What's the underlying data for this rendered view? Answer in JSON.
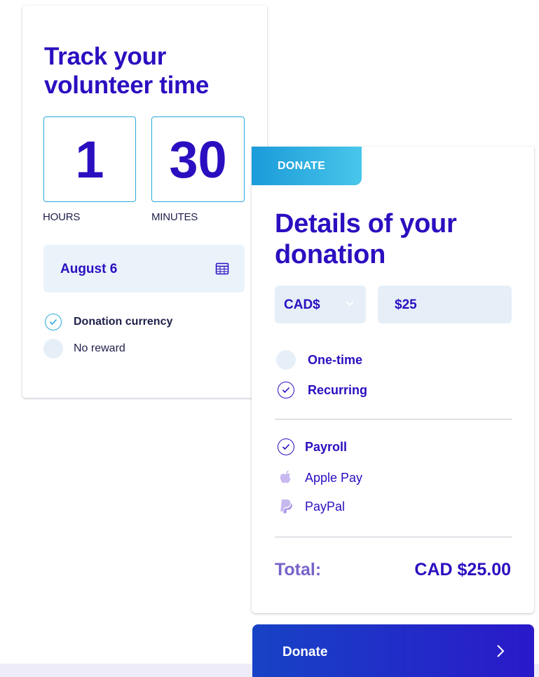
{
  "volunteer": {
    "title": "Track your volunteer time",
    "hours_value": "1",
    "minutes_value": "30",
    "hours_label": "HOURS",
    "minutes_label": "MINUTES",
    "date_value": "August 6",
    "options": [
      {
        "label": "Donation currency",
        "checked": true
      },
      {
        "label": "No reward",
        "checked": false
      }
    ]
  },
  "donation": {
    "tab_label": "DONATE",
    "title": "Details of your donation",
    "currency": "CAD$",
    "amount": "$25",
    "frequency": [
      {
        "label": "One-time",
        "checked": false
      },
      {
        "label": "Recurring",
        "checked": true
      }
    ],
    "payment_methods": [
      {
        "label": "Payroll",
        "icon": "check-circle-icon",
        "selected": true
      },
      {
        "label": "Apple Pay",
        "icon": "apple-icon",
        "selected": false
      },
      {
        "label": "PayPal",
        "icon": "paypal-icon",
        "selected": false
      }
    ],
    "total_label": "Total:",
    "total_value": "CAD $25.00",
    "button_label": "Donate"
  },
  "colors": {
    "primary": "#2a0fc0",
    "accent": "#29a9dd",
    "field_bg": "#e6eff8",
    "muted_purple": "#7963c9"
  }
}
